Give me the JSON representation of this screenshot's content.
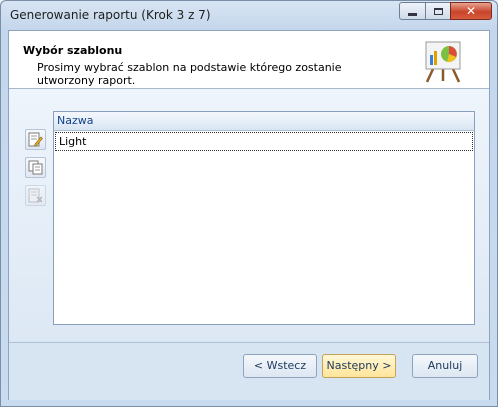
{
  "window": {
    "title": "Generowanie raportu (Krok 3 z 7)"
  },
  "header": {
    "title": "Wybór szablonu",
    "description": "Prosimy wybrać szablon na podstawie którego zostanie utworzony raport.",
    "icon": "chart-easel-icon"
  },
  "toolbar": {
    "icons": [
      "edit-template-icon",
      "copy-template-icon",
      "delete-template-icon"
    ]
  },
  "list": {
    "column_header": "Nazwa",
    "rows": [
      {
        "name": "Light"
      }
    ]
  },
  "buttons": {
    "back": "< Wstecz",
    "next": "Następny >",
    "cancel": "Anuluj"
  },
  "colors": {
    "accent": "#ffe59a",
    "close": "#c8452b"
  }
}
